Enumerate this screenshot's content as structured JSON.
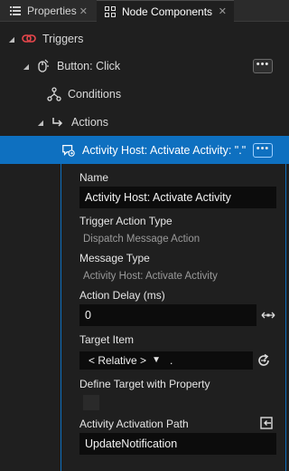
{
  "tabs": [
    {
      "label": "Properties",
      "close": "✕"
    },
    {
      "label": "Node Components",
      "close": "✕"
    }
  ],
  "tree": {
    "triggers": "Triggers",
    "button_click": "Button: Click",
    "conditions": "Conditions",
    "actions": "Actions",
    "activity": "Activity Host: Activate Activity: \".\"",
    "menu_glyph": "•••"
  },
  "props": {
    "name_label": "Name",
    "name_value": "Activity Host: Activate Activity",
    "trigger_type_label": "Trigger Action Type",
    "trigger_type_value": "Dispatch Message Action",
    "message_type_label": "Message Type",
    "message_type_value": "Activity Host: Activate Activity",
    "delay_label": "Action Delay (ms)",
    "delay_value": "0",
    "target_label": "Target Item",
    "target_select": "< Relative >",
    "target_path": ".",
    "define_target_label": "Define Target with Property",
    "path_label": "Activity Activation Path",
    "path_value": "UpdateNotification"
  },
  "colors": {
    "selection": "#0e70c0",
    "background": "#1f1f1f",
    "field": "#0c0c0c"
  },
  "icons": {
    "properties_tab": "list-icon",
    "node_components_tab": "node-tree-icon",
    "triggers": "trigger-link-icon",
    "button_click": "mouse-click-icon",
    "conditions": "condition-tree-icon",
    "actions": "action-arrow-icon",
    "activity": "message-action-icon",
    "delay": "drag-value-icon",
    "target": "reset-target-icon",
    "path": "bind-property-icon"
  }
}
